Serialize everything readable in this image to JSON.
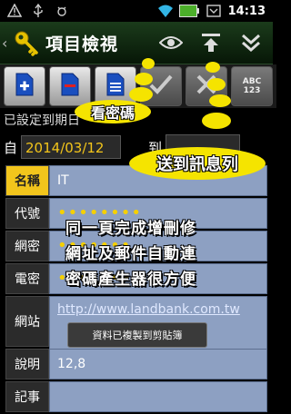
{
  "status_bar": {
    "time": "14:13",
    "icons": [
      "warning-icon",
      "usb-icon",
      "usb-debug-icon",
      "wifi-icon",
      "battery-icon",
      "notification-icon"
    ]
  },
  "title_bar": {
    "title": "項目檢視",
    "icons": [
      "key-icon",
      "eye-icon",
      "send-up-icon",
      "chevron-down-icon"
    ]
  },
  "toolbar": {
    "buttons": [
      "add-icon",
      "delete-icon",
      "document-icon",
      "check-icon",
      "close-icon",
      "abc-123-icon"
    ],
    "abc_label_top": "ABC",
    "abc_label_bottom": "123"
  },
  "filter": {
    "set_label": "已設定到期日",
    "from_label": "自",
    "from_date": "2014/03/12",
    "to_label": "到"
  },
  "fields": [
    {
      "label": "名稱",
      "value": "IT"
    },
    {
      "label": "代號",
      "value": "••••••••"
    },
    {
      "label": "網密",
      "value": "•••••••"
    },
    {
      "label": "電密",
      "value": "•••••••"
    },
    {
      "label": "網站",
      "value": "http://www.landbank.com.tw"
    },
    {
      "label": "說明",
      "value": "12,8"
    },
    {
      "label": "記事",
      "value": ""
    }
  ],
  "overlays": {
    "see_password": "看密碼",
    "send_to_messages": "送到訊息列",
    "promo_lines": [
      "同一頁完成增刪修",
      "網址及郵件自動連",
      "密碼產生器很方便"
    ]
  },
  "toast": {
    "message": "資料已複製到剪貼簿"
  },
  "colors": {
    "title_bg": "#0f2a0f",
    "highlight": "#f2c51c",
    "field_bg": "#8da0c2",
    "date_text": "#f3c51a",
    "bubble": "#f5e400"
  }
}
